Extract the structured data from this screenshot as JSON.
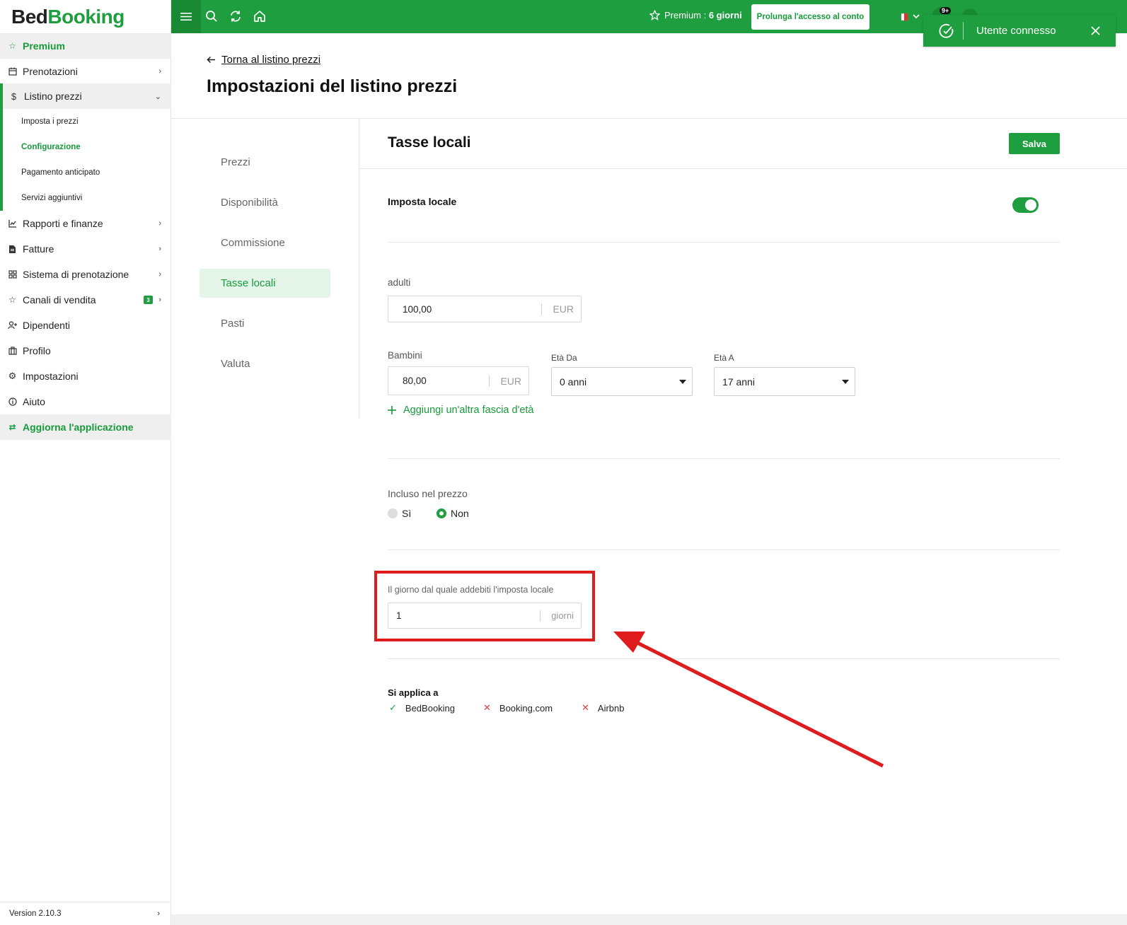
{
  "brand": {
    "part1": "Bed",
    "part2": "Booking"
  },
  "sidebar": {
    "premium": "Premium",
    "items": [
      {
        "label": "Prenotazioni",
        "icon": "calendar-icon"
      },
      {
        "label": "Listino prezzi",
        "icon": "dollar-icon"
      },
      {
        "label": "Rapporti e finanze",
        "icon": "chart-icon"
      },
      {
        "label": "Fatture",
        "icon": "invoice-icon"
      },
      {
        "label": "Sistema di prenotazione",
        "icon": "grid-icon"
      },
      {
        "label": "Canali di vendita",
        "icon": "star-icon",
        "badge": "3"
      },
      {
        "label": "Dipendenti",
        "icon": "user-plus-icon"
      },
      {
        "label": "Profilo",
        "icon": "building-icon"
      },
      {
        "label": "Impostazioni",
        "icon": "gear-icon"
      },
      {
        "label": "Aiuto",
        "icon": "info-icon"
      }
    ],
    "subitems": [
      "Imposta i prezzi",
      "Configurazione",
      "Pagamento anticipato",
      "Servizi aggiuntivi"
    ],
    "update": "Aggiorna l'applicazione",
    "version": "Version 2.10.3"
  },
  "topbar": {
    "premium_label": "Premium : ",
    "premium_days": "6 giorni",
    "extend_button": "Prolunga l'accesso al conto",
    "notif_count": "9+"
  },
  "toast": {
    "message": "Utente connesso"
  },
  "header": {
    "back_link": "Torna al listino prezzi",
    "title": "Impostazioni del listino prezzi"
  },
  "tabs": [
    "Prezzi",
    "Disponibilità",
    "Commissione",
    "Tasse locali",
    "Pasti",
    "Valuta"
  ],
  "panel": {
    "title": "Tasse locali",
    "save_button": "Salva",
    "tax_toggle_label": "Imposta locale",
    "adults_label": "adulti",
    "adults_value": "100,00",
    "currency": "EUR",
    "children_label": "Bambini",
    "children_value": "80,00",
    "age_from_label": "Età Da",
    "age_from_value": "0 anni",
    "age_to_label": "Età A",
    "age_to_value": "17 anni",
    "add_age_band": "Aggiungi un'altra fascia d'età",
    "included_label": "Incluso nel prezzo",
    "radio_yes": "Sì",
    "radio_no": "Non",
    "day_label": "Il giorno dal quale addebiti l'imposta locale",
    "day_value": "1",
    "day_unit": "giorni",
    "applies_label": "Si applica a",
    "applies": [
      {
        "name": "BedBooking",
        "state": "yes"
      },
      {
        "name": "Booking.com",
        "state": "no"
      },
      {
        "name": "Airbnb",
        "state": "no"
      }
    ]
  },
  "colors": {
    "brand_green": "#1e9e3e",
    "annotation_red": "#e01b1b"
  }
}
